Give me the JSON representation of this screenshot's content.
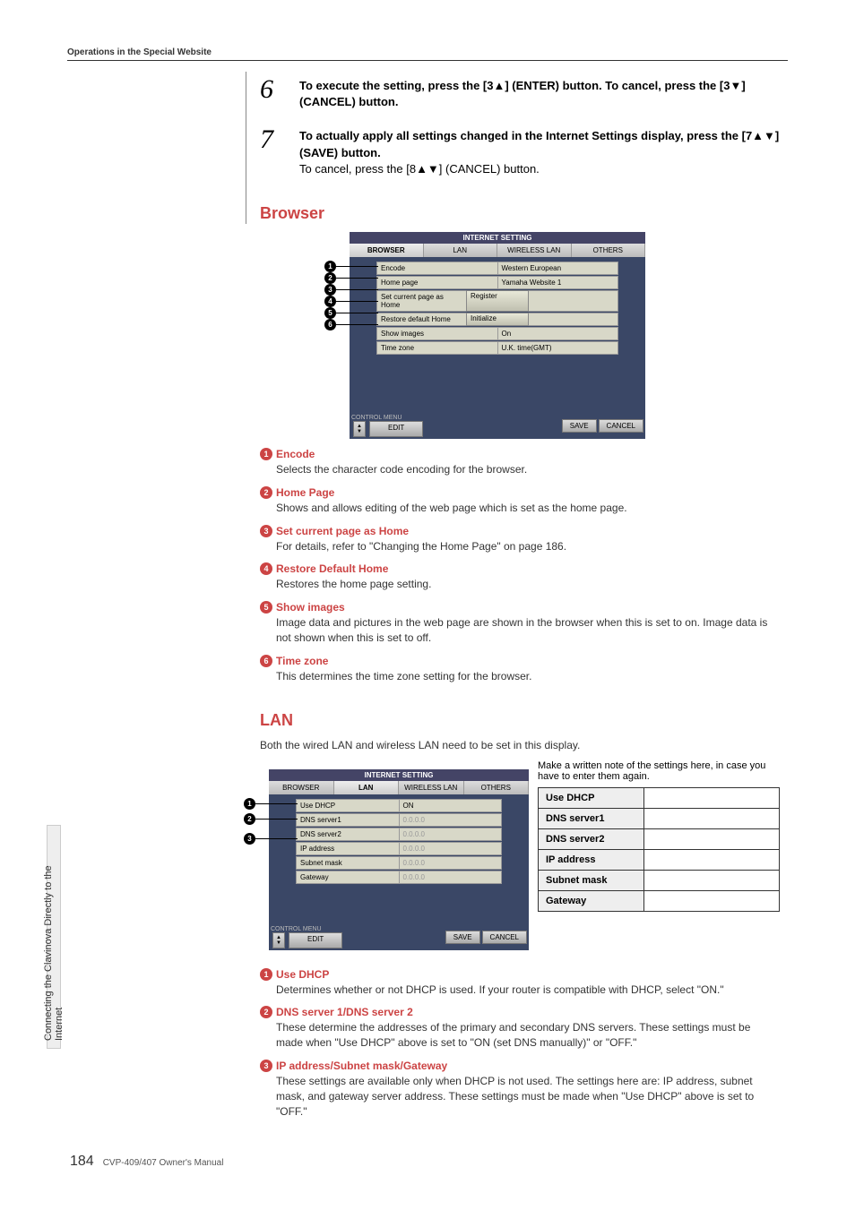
{
  "header": {
    "title": "Operations in the Special Website"
  },
  "steps": {
    "s6": {
      "num": "6",
      "bold": "To execute the setting, press the [3▲] (ENTER) button. To cancel, press the [3▼] (CANCEL) button."
    },
    "s7": {
      "num": "7",
      "bold": "To actually apply all settings changed in the Internet Settings display, press the [7▲▼] (SAVE) button.",
      "plain": "To cancel, press the [8▲▼] (CANCEL) button."
    }
  },
  "browser": {
    "title": "Browser",
    "ss": {
      "title": "INTERNET SETTING",
      "tabs": [
        "BROWSER",
        "LAN",
        "WIRELESS LAN",
        "OTHERS"
      ],
      "rows": [
        {
          "label": "Encode",
          "value": "Western European"
        },
        {
          "label": "Home page",
          "value": "Yamaha Website 1"
        },
        {
          "label": "Set current page as Home",
          "btn": "Register"
        },
        {
          "label": "Restore default Home",
          "btn": "Initialize"
        },
        {
          "label": "Show images",
          "value": "On"
        },
        {
          "label": "Time zone",
          "value": "U.K. time(GMT)"
        }
      ],
      "ctrl_menu": "CONTROL MENU",
      "edit": "EDIT",
      "save": "SAVE",
      "cancel": "CANCEL"
    },
    "defs": [
      {
        "n": "1",
        "head": "Encode",
        "body": "Selects the character code encoding for the browser."
      },
      {
        "n": "2",
        "head": "Home Page",
        "body": "Shows and allows editing of the web page which is set as the home page."
      },
      {
        "n": "3",
        "head": "Set current page as Home",
        "body": "For details, refer to \"Changing the Home Page\" on page 186."
      },
      {
        "n": "4",
        "head": "Restore Default Home",
        "body": "Restores the home page setting."
      },
      {
        "n": "5",
        "head": "Show images",
        "body": "Image data and pictures in the web page are shown in the browser when this is set to on. Image data is not shown when this is set to off."
      },
      {
        "n": "6",
        "head": "Time zone",
        "body": "This determines the time zone setting for the browser."
      }
    ]
  },
  "lan": {
    "title": "LAN",
    "intro": "Both the wired LAN and wireless LAN need to be set in this display.",
    "ss": {
      "title": "INTERNET SETTING",
      "tabs": [
        "BROWSER",
        "LAN",
        "WIRELESS LAN",
        "OTHERS"
      ],
      "rows": [
        {
          "label": "Use DHCP",
          "value": "ON"
        },
        {
          "label": "DNS server1",
          "value": "0.0.0.0",
          "dim": true
        },
        {
          "label": "DNS server2",
          "value": "0.0.0.0",
          "dim": true
        },
        {
          "label": "IP address",
          "value": "0.0.0.0",
          "dim": true
        },
        {
          "label": "Subnet mask",
          "value": "0.0.0.0",
          "dim": true
        },
        {
          "label": "Gateway",
          "value": "0.0.0.0",
          "dim": true
        }
      ],
      "ctrl_menu": "CONTROL MENU",
      "edit": "EDIT",
      "save": "SAVE",
      "cancel": "CANCEL"
    },
    "note": "Make a written note of the settings here, in case you have to enter them again.",
    "note_rows": [
      "Use DHCP",
      "DNS server1",
      "DNS server2",
      "IP address",
      "Subnet mask",
      "Gateway"
    ],
    "defs": [
      {
        "n": "1",
        "head": "Use DHCP",
        "body": "Determines whether or not DHCP is used. If your router is compatible with DHCP, select \"ON.\""
      },
      {
        "n": "2",
        "head": "DNS server 1/DNS server 2",
        "body": "These determine the addresses of the primary and secondary DNS servers. These settings must be made when \"Use DHCP\" above is set to \"ON (set DNS manually)\" or \"OFF.\""
      },
      {
        "n": "3",
        "head": "IP address/Subnet mask/Gateway",
        "body": "These settings are available only when DHCP is not used. The settings here are: IP address, subnet mask, and gateway server address. These settings must be made when \"Use DHCP\" above is set to \"OFF.\""
      }
    ]
  },
  "side_tab": "Connecting the Clavinova Directly to the Internet",
  "footer": {
    "page": "184",
    "manual": "CVP-409/407 Owner's Manual"
  }
}
